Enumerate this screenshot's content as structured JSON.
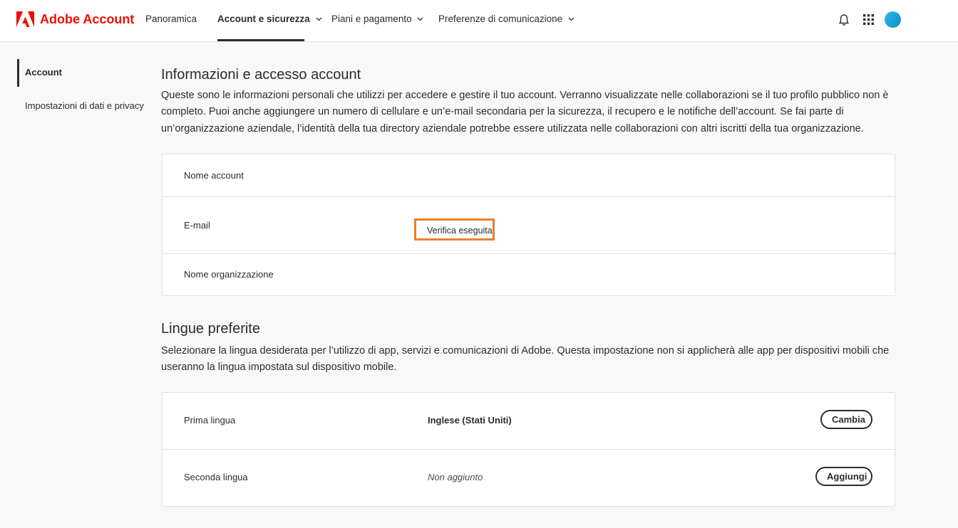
{
  "header": {
    "brand": "Adobe Account",
    "nav": [
      {
        "label": "Panoramica"
      },
      {
        "label": "Account e sicurezza"
      },
      {
        "label": "Piani e pagamento"
      },
      {
        "label": "Preferenze di comunicazione"
      }
    ],
    "icons": [
      "bell-icon",
      "apps-grid-icon",
      "avatar"
    ],
    "brand_color": "#eb1000"
  },
  "sidebar": {
    "items": [
      {
        "label": "Account"
      },
      {
        "label": "Impostazioni di dati e privacy"
      }
    ]
  },
  "account_info": {
    "title": "Informazioni e accesso account",
    "description": "Queste sono le informazioni personali che utilizzi per accedere e gestire il tuo account. Verranno visualizzate nelle collaborazioni se il tuo profilo pubblico non è completo. Puoi anche aggiungere un numero di cellulare e un’e-mail secondaria per la sicurezza, il recupero e le notifiche dell’account. Se fai parte di un’organizzazione aziendale, l’identità della tua directory aziendale potrebbe essere utilizzata nelle collaborazioni con altri iscritti della tua organizzazione.",
    "rows": [
      {
        "label": "Nome account"
      },
      {
        "label": "E-mail",
        "badge": "Verifica eseguita"
      },
      {
        "label": "Nome organizzazione"
      }
    ],
    "highlight_color": "#e8812b"
  },
  "languages": {
    "title": "Lingue preferite",
    "description": "Selezionare la lingua desiderata per l’utilizzo di app, servizi e comunicazioni di Adobe. Questa impostazione non si applicherà alle app per dispositivi mobili che useranno la lingua impostata sul dispositivo mobile.",
    "rows": [
      {
        "label": "Prima lingua",
        "value": "Inglese (Stati Uniti)",
        "button": "Cambia"
      },
      {
        "label": "Seconda lingua",
        "value": "Non aggiunto",
        "button": "Aggiungi"
      }
    ]
  }
}
